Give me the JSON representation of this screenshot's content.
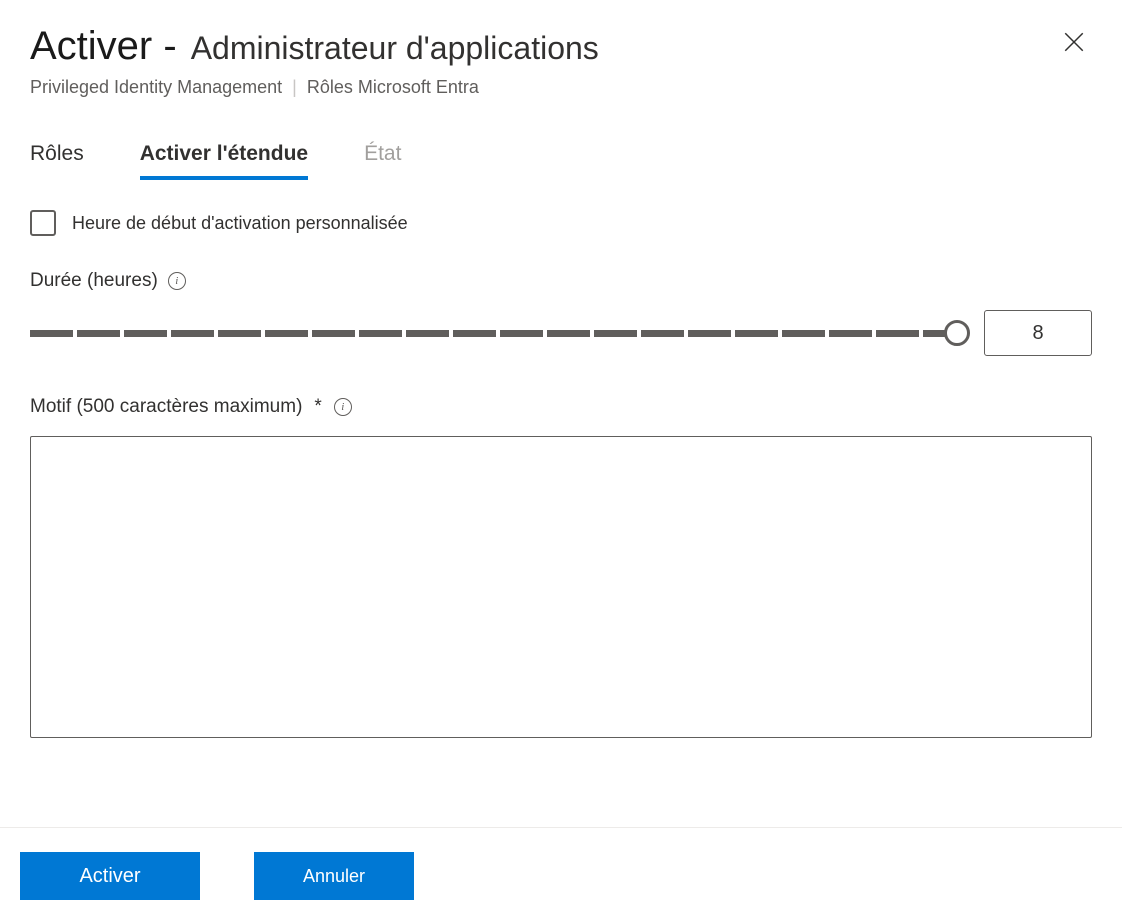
{
  "header": {
    "title_prefix": "Activer -",
    "title_role": "Administrateur d'applications",
    "subtitle_service": "Privileged Identity Management",
    "subtitle_section": "Rôles Microsoft Entra"
  },
  "tabs": {
    "roles": "Rôles",
    "activate_scope": "Activer l'étendue",
    "status": "État"
  },
  "form": {
    "custom_start_label": "Heure de début d'activation personnalisée",
    "custom_start_checked": false,
    "duration_label": "Durée (heures)",
    "duration_value": "8",
    "reason_label": "Motif (500 caractères maximum)",
    "reason_required_marker": "*",
    "reason_value": ""
  },
  "footer": {
    "activate_label": "Activer",
    "cancel_label": "Annuler"
  }
}
